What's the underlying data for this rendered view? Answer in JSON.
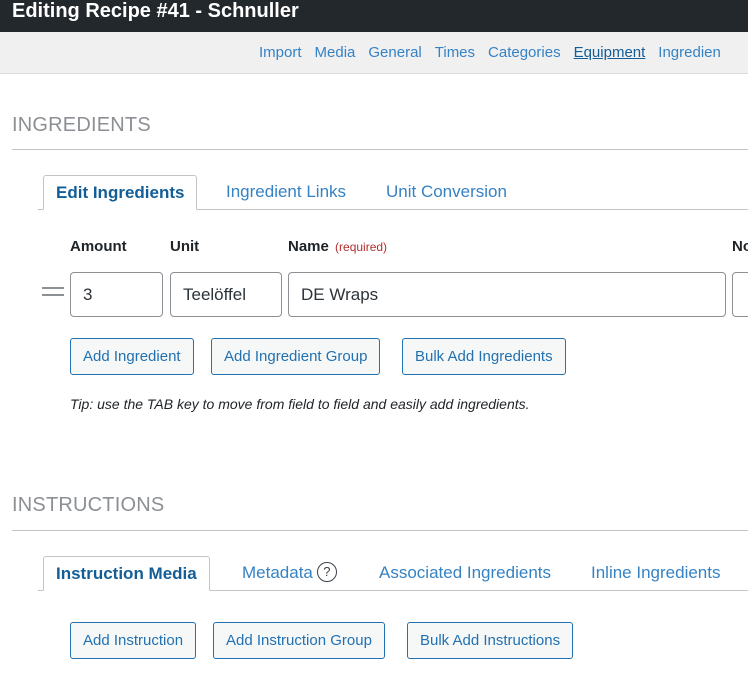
{
  "window": {
    "title": "Editing Recipe #41 - Schnuller"
  },
  "nav": {
    "links": [
      "Import",
      "Media",
      "General",
      "Times",
      "Categories",
      "Equipment",
      "Ingredien"
    ],
    "active": "Equipment"
  },
  "ingredients_section": {
    "heading": "INGREDIENTS",
    "tabs": [
      "Edit Ingredients",
      "Ingredient Links",
      "Unit Conversion"
    ],
    "active_tab": "Edit Ingredients",
    "columns": {
      "amount": "Amount",
      "unit": "Unit",
      "name": "Name",
      "name_required": "(required)",
      "notes_partial": "No"
    },
    "rows": [
      {
        "amount": "3",
        "unit": "Teelöffel",
        "name": "DE Wraps"
      }
    ],
    "buttons": {
      "add_ingredient": "Add Ingredient",
      "add_group": "Add Ingredient Group",
      "bulk_add": "Bulk Add Ingredients"
    },
    "tip": "Tip: use the TAB key to move from field to field and easily add ingredients."
  },
  "instructions_section": {
    "heading": "INSTRUCTIONS",
    "tabs": [
      "Instruction Media",
      "Metadata",
      "Associated Ingredients",
      "Inline Ingredients"
    ],
    "active_tab": "Instruction Media",
    "help_glyph": "?",
    "buttons": {
      "add_instruction": "Add Instruction",
      "add_group": "Add Instruction Group",
      "bulk_add": "Bulk Add Instructions"
    }
  },
  "colors": {
    "titlebar_bg": "#23282d",
    "link": "#3582c4",
    "link_active": "#135e96",
    "button_border": "#2271b1",
    "required": "#b32d2e"
  }
}
